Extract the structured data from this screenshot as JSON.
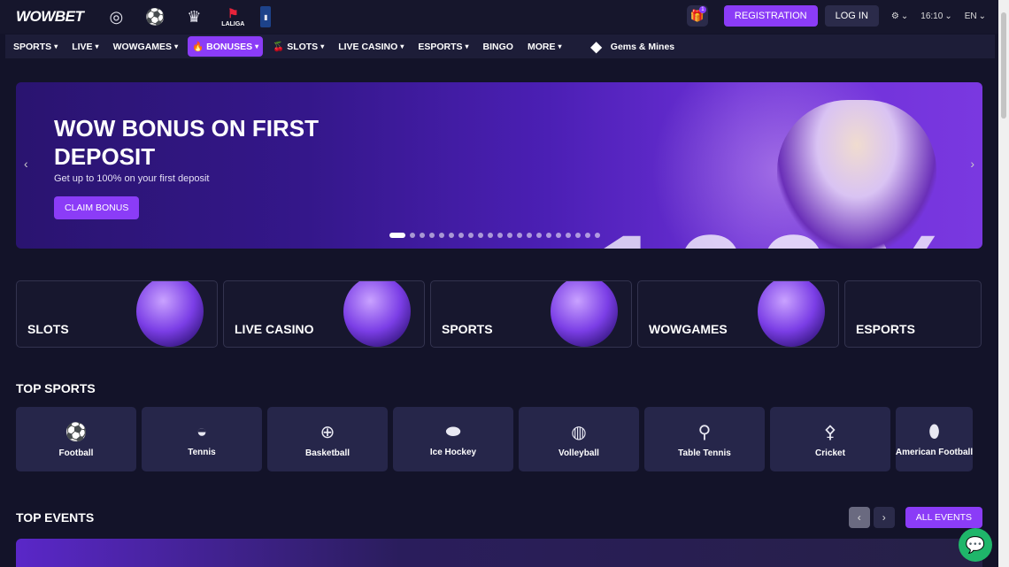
{
  "brand": {
    "logo_wow": "WOW",
    "logo_bet": "BET"
  },
  "leagues": [
    {
      "icon": "champions-league-icon",
      "glyph": "⚽"
    },
    {
      "icon": "football-icon",
      "glyph": "⚽"
    },
    {
      "icon": "premier-league-icon",
      "glyph": "🦁"
    },
    {
      "icon": "laliga-icon",
      "glyph": "LALIGA"
    },
    {
      "icon": "nba-icon",
      "glyph": "🏀"
    }
  ],
  "header": {
    "gift_badge": "1",
    "registration": "REGISTRATION",
    "login": "LOG IN",
    "time": "16:10",
    "lang": "EN"
  },
  "nav": {
    "items": [
      "SPORTS",
      "LIVE",
      "WOWGAMES",
      "BONUSES",
      "SLOTS",
      "LIVE CASINO",
      "ESPORTS",
      "BINGO",
      "MORE"
    ],
    "gems": "Gems & Mines"
  },
  "banner": {
    "title": "WOW BONUS ON FIRST DEPOSIT",
    "subtitle": "Get up to 100% on your first deposit",
    "cta": "CLAIM BONUS",
    "big_text": "100%",
    "slide_count": 21,
    "active_slide": 1
  },
  "categories": [
    "SLOTS",
    "LIVE CASINO",
    "SPORTS",
    "WOWGAMES",
    "ESPORTS"
  ],
  "top_sports": {
    "title": "TOP SPORTS",
    "items": [
      "Football",
      "Tennis",
      "Basketball",
      "Ice Hockey",
      "Volleyball",
      "Table Tennis",
      "Cricket",
      "American Football"
    ]
  },
  "top_events": {
    "title": "TOP EVENTS",
    "all": "ALL EVENTS"
  }
}
